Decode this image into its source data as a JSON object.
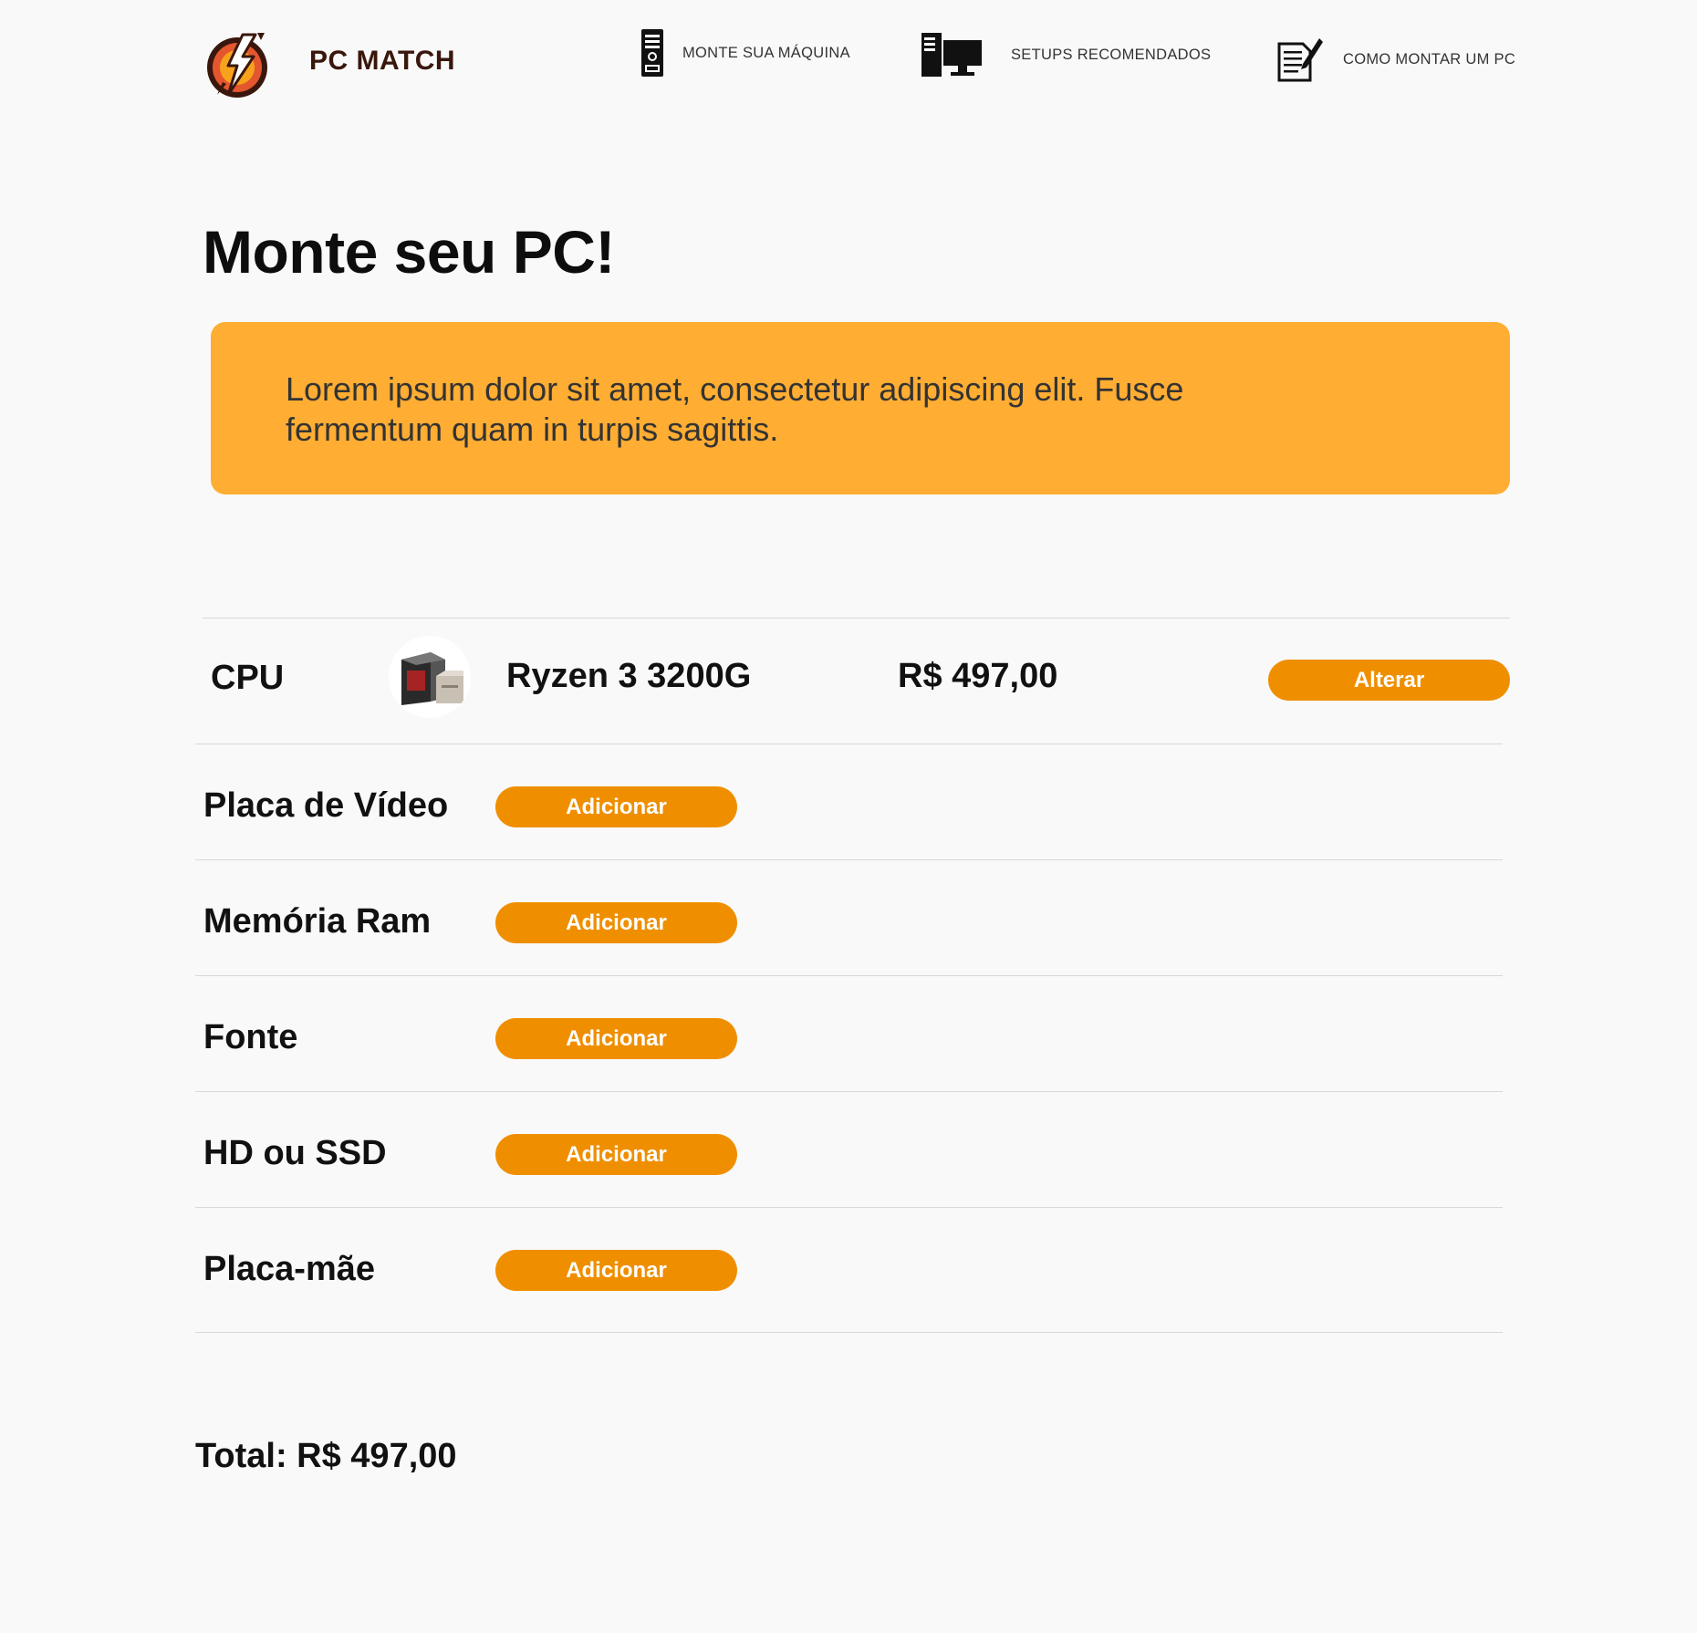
{
  "header": {
    "brand": "PC MATCH",
    "logo_icon": "lightning-shield-logo",
    "nav": [
      {
        "label": "MONTE SUA MÁQUINA",
        "icon": "pc-tower-icon"
      },
      {
        "label": "SETUPS RECOMENDADOS",
        "icon": "desktop-setup-icon"
      },
      {
        "label": "COMO MONTAR UM PC",
        "icon": "document-pencil-icon"
      }
    ]
  },
  "main": {
    "title": "Monte seu PC!",
    "banner_text": "Lorem ipsum dolor sit amet, consectetur adipiscing elit. Fusce fermentum quam in turpis sagittis.",
    "selected": {
      "category": "CPU",
      "product": "Ryzen 3 3200G",
      "price": "R$ 497,00",
      "button": "Alterar",
      "image_icon": "cpu-box-image"
    },
    "components": [
      {
        "label": "Placa de Vídeo",
        "button": "Adicionar"
      },
      {
        "label": "Memória Ram",
        "button": "Adicionar"
      },
      {
        "label": "Fonte",
        "button": "Adicionar"
      },
      {
        "label": "HD ou SSD",
        "button": "Adicionar"
      },
      {
        "label": "Placa-mãe",
        "button": "Adicionar"
      }
    ],
    "total": "Total: R$ 497,00"
  },
  "colors": {
    "banner": "#ffad33",
    "button": "#ef8f00",
    "brand": "#3a170c",
    "background": "#f9f9f9"
  }
}
